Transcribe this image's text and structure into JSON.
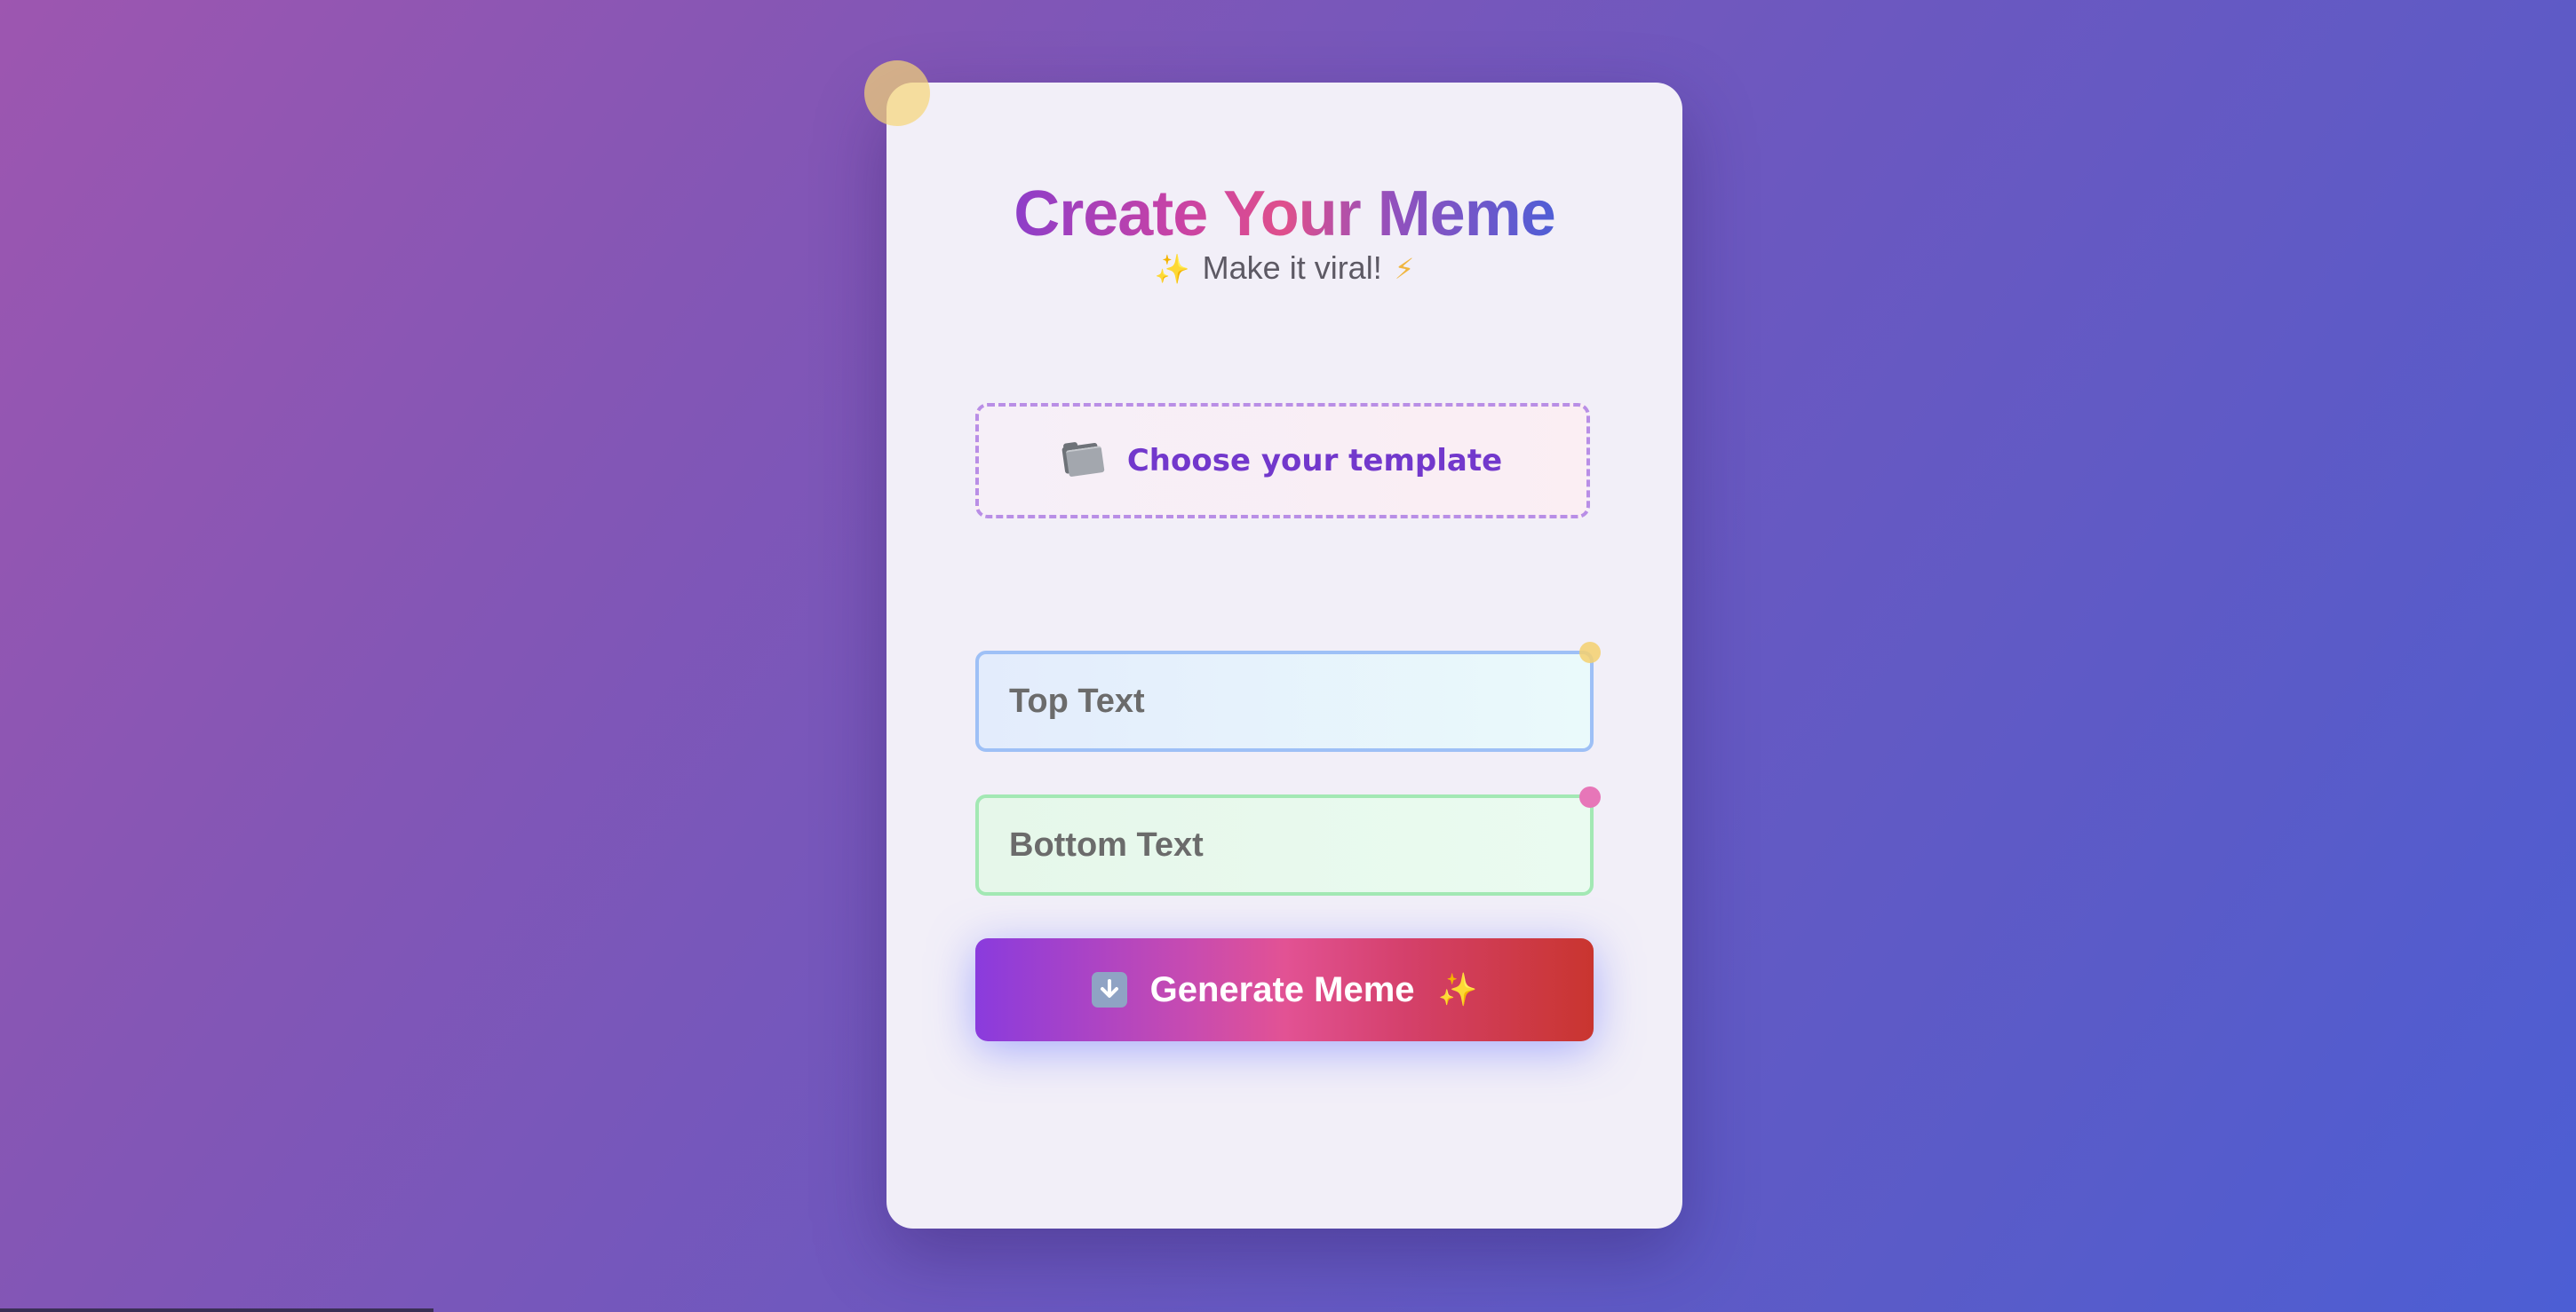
{
  "header": {
    "title": "Create Your Meme",
    "subtitle": "Make it viral!",
    "subtitle_left_icon": "sparkles-icon",
    "subtitle_right_icon": "lightning-icon"
  },
  "template_picker": {
    "label": "Choose your template",
    "icon": "folder-icon"
  },
  "fields": {
    "top_placeholder": "Top Text",
    "top_value": "",
    "bottom_placeholder": "Bottom Text",
    "bottom_value": ""
  },
  "generate": {
    "label": "Generate Meme",
    "left_icon": "down-arrow-icon",
    "right_icon": "sparkles-icon"
  },
  "colors": {
    "background_start": "#9d56b0",
    "background_end": "#4c5ed4",
    "card": "#f2eff8",
    "template_text": "#7238cc",
    "top_field_border": "#9ec0f6",
    "bottom_field_border": "#a3e8b4",
    "button_start": "#8a3bdd",
    "button_end": "#c9352f"
  }
}
